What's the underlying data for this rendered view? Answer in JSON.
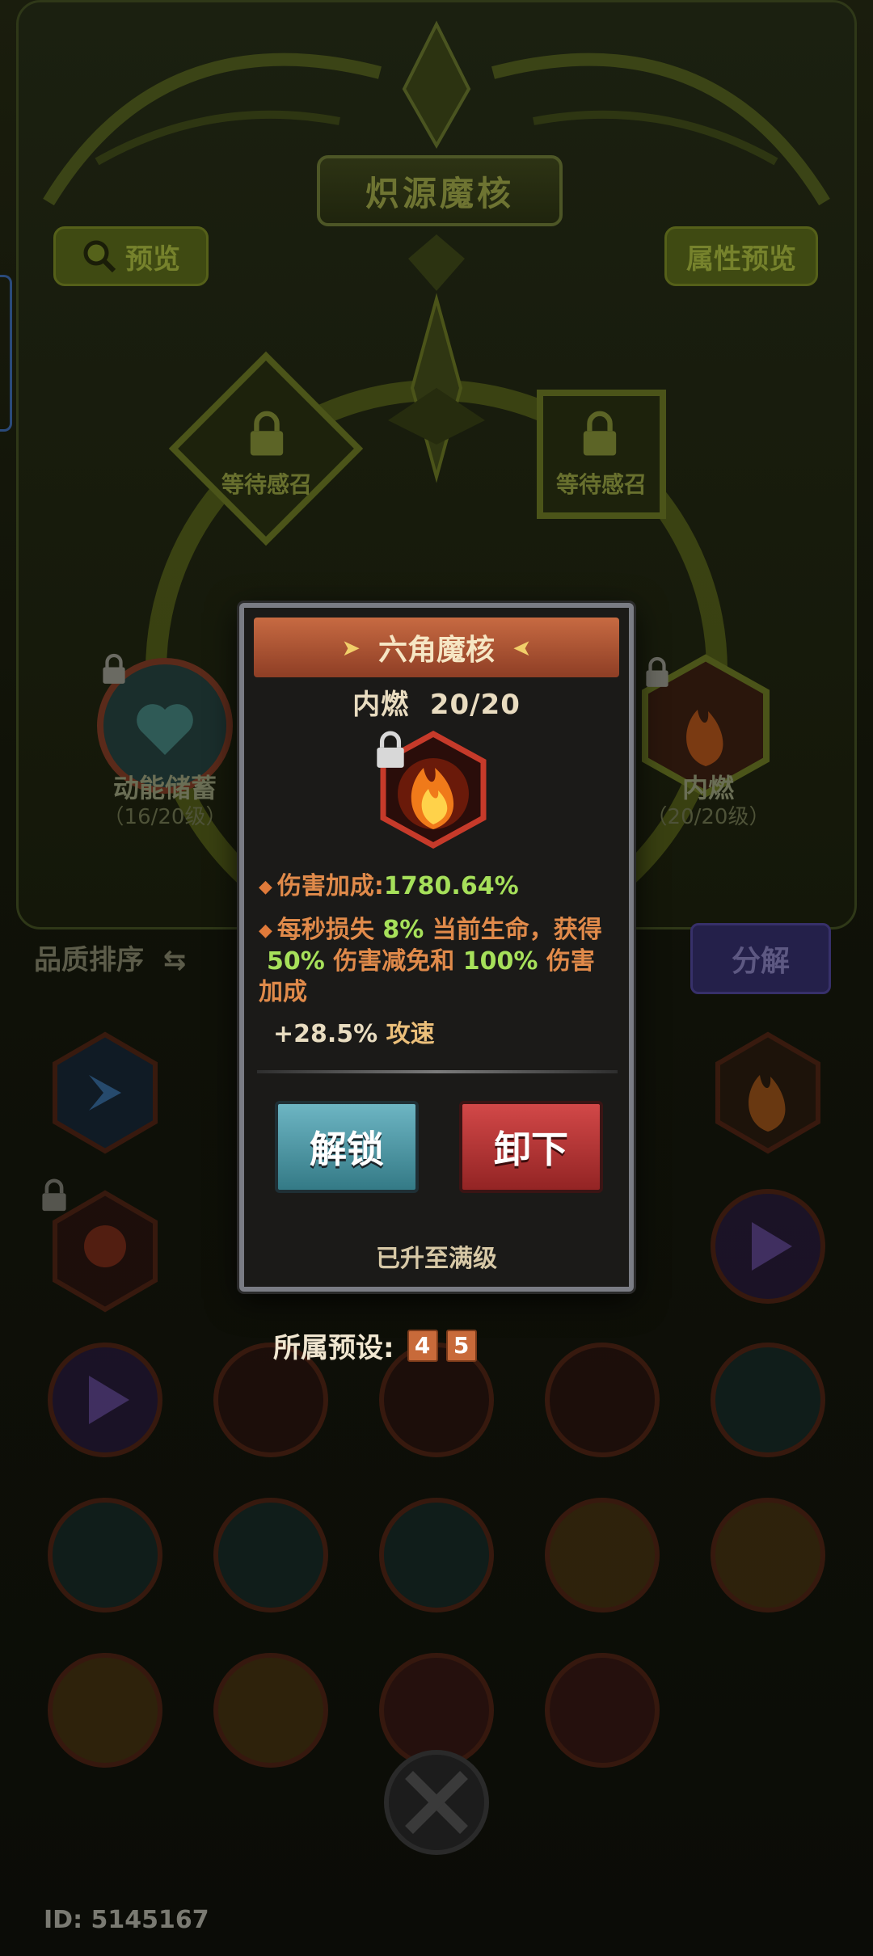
{
  "header": {
    "title": "炽源魔核",
    "preview_button": "预览",
    "attribute_preview_button": "属性预览"
  },
  "slots": {
    "left_slot_text": "等待感召",
    "right_slot_text": "等待感召"
  },
  "side_cores": {
    "left_name": "动能储蓄",
    "left_level": "（16/20级）",
    "right_name": "内燃",
    "right_level": "（20/20级）"
  },
  "toolbar": {
    "sort_label": "品质排序",
    "decompose_button": "分解"
  },
  "modal": {
    "banner_title": "六角魔核",
    "subtitle": "内燃  20/20",
    "stat_1_prefix": "伤害加成:",
    "stat_1_value": "1780.64%",
    "stat_2_a": "每秒损失 ",
    "stat_2_pct1": "8%",
    "stat_2_b": " 当前生命，获得",
    "stat_2_pct2": "50%",
    "stat_2_c": " 伤害减免和 ",
    "stat_2_pct3": "100%",
    "stat_2_d": " 伤害",
    "stat_2_e": "加成",
    "speed_value": "+28.5%",
    "speed_unit": " 攻速",
    "unlock_button": "解锁",
    "unequip_button": "卸下",
    "maxed_text": "已升至满级"
  },
  "preset": {
    "label": "所属预设:",
    "chips": [
      "4",
      "5"
    ]
  },
  "footer": {
    "player_id": "ID: 5145167"
  },
  "colors": {
    "accent_green": "#a6e05a",
    "stat_orange": "#e08a4a",
    "banner": "#c76a42",
    "unlock_teal": "#4e9aa8",
    "unequip_red": "#b53636"
  }
}
